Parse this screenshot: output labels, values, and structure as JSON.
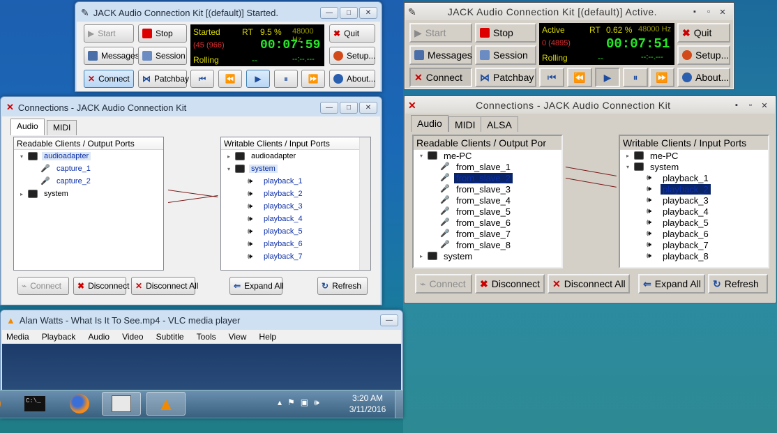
{
  "jack_left": {
    "title": "JACK Audio Connection Kit [(default)] Started.",
    "start": "Start",
    "stop": "Stop",
    "quit": "Quit",
    "messages": "Messages",
    "session": "Session",
    "setup": "Setup...",
    "connect": "Connect",
    "patchbay": "Patchbay",
    "about": "About...",
    "lcd": {
      "status": "Started",
      "rt": "RT",
      "load": "9.5 %",
      "rate": "48000 Hz",
      "xruns": "(45 (966)",
      "time": "00:07:59",
      "state": "Rolling",
      "dash1": "--",
      "dash2": "--:--.---"
    }
  },
  "conn_left": {
    "title": "Connections - JACK Audio Connection Kit",
    "tabs": [
      "Audio",
      "MIDI"
    ],
    "readable_header": "Readable Clients / Output Ports",
    "writable_header": "Writable Clients / Input Ports",
    "readable": [
      {
        "label": "audioadapter",
        "kind": "client",
        "open": true,
        "sel": true
      },
      {
        "label": "capture_1",
        "kind": "port"
      },
      {
        "label": "capture_2",
        "kind": "port"
      },
      {
        "label": "system",
        "kind": "client",
        "open": false
      }
    ],
    "writable": [
      {
        "label": "audioadapter",
        "kind": "client",
        "open": false
      },
      {
        "label": "system",
        "kind": "client",
        "open": true,
        "sel": true
      },
      {
        "label": "playback_1",
        "kind": "port"
      },
      {
        "label": "playback_2",
        "kind": "port"
      },
      {
        "label": "playback_3",
        "kind": "port"
      },
      {
        "label": "playback_4",
        "kind": "port"
      },
      {
        "label": "playback_5",
        "kind": "port"
      },
      {
        "label": "playback_6",
        "kind": "port"
      },
      {
        "label": "playback_7",
        "kind": "port"
      }
    ],
    "buttons": {
      "connect": "Connect",
      "disconnect": "Disconnect",
      "disconnect_all": "Disconnect All",
      "expand_all": "Expand All",
      "refresh": "Refresh"
    }
  },
  "vlc": {
    "title": "Alan Watts - What Is It To See.mp4 - VLC media player",
    "menu": [
      "Media",
      "Playback",
      "Audio",
      "Video",
      "Subtitle",
      "Tools",
      "View",
      "Help"
    ]
  },
  "taskbar": {
    "time": "3:20 AM",
    "date": "3/11/2016",
    "console": "C:\\_"
  },
  "jack_right": {
    "title": "JACK Audio Connection Kit [(default)] Active.",
    "start": "Start",
    "stop": "Stop",
    "quit": "Quit",
    "messages": "Messages",
    "session": "Session",
    "setup": "Setup...",
    "connect": "Connect",
    "patchbay": "Patchbay",
    "about": "About...",
    "lcd": {
      "status": "Active",
      "rt": "RT",
      "load": "0.62 %",
      "rate": "48000 Hz",
      "xruns": "0 (4895)",
      "time": "00:07:51",
      "state": "Rolling",
      "dash1": "--",
      "dash2": "--:--.---"
    }
  },
  "conn_right": {
    "title": "Connections - JACK Audio Connection Kit",
    "tabs": [
      "Audio",
      "MIDI",
      "ALSA"
    ],
    "readable_header": "Readable Clients / Output Por",
    "writable_header": "Writable Clients / Input Ports",
    "readable": [
      {
        "label": "me-PC",
        "kind": "client",
        "open": true
      },
      {
        "label": "from_slave_1",
        "kind": "port"
      },
      {
        "label": "from_slave_2",
        "kind": "port",
        "sel": true
      },
      {
        "label": "from_slave_3",
        "kind": "port"
      },
      {
        "label": "from_slave_4",
        "kind": "port"
      },
      {
        "label": "from_slave_5",
        "kind": "port"
      },
      {
        "label": "from_slave_6",
        "kind": "port"
      },
      {
        "label": "from_slave_7",
        "kind": "port"
      },
      {
        "label": "from_slave_8",
        "kind": "port"
      },
      {
        "label": "system",
        "kind": "client",
        "open": false
      }
    ],
    "writable": [
      {
        "label": "me-PC",
        "kind": "client",
        "open": false
      },
      {
        "label": "system",
        "kind": "client",
        "open": true
      },
      {
        "label": "playback_1",
        "kind": "port"
      },
      {
        "label": "playback_2",
        "kind": "port",
        "sel": true
      },
      {
        "label": "playback_3",
        "kind": "port"
      },
      {
        "label": "playback_4",
        "kind": "port"
      },
      {
        "label": "playback_5",
        "kind": "port"
      },
      {
        "label": "playback_6",
        "kind": "port"
      },
      {
        "label": "playback_7",
        "kind": "port"
      },
      {
        "label": "playback_8",
        "kind": "port"
      }
    ],
    "buttons": {
      "connect": "Connect",
      "disconnect": "Disconnect",
      "disconnect_all": "Disconnect All",
      "expand_all": "Expand All",
      "refresh": "Refresh"
    }
  },
  "colors": {
    "lcd_green": "#27e827",
    "lcd_yellow": "#dada00",
    "lcd_red": "#e03030",
    "selection": "#0a246a",
    "connection_line": "#7a1a1a"
  }
}
